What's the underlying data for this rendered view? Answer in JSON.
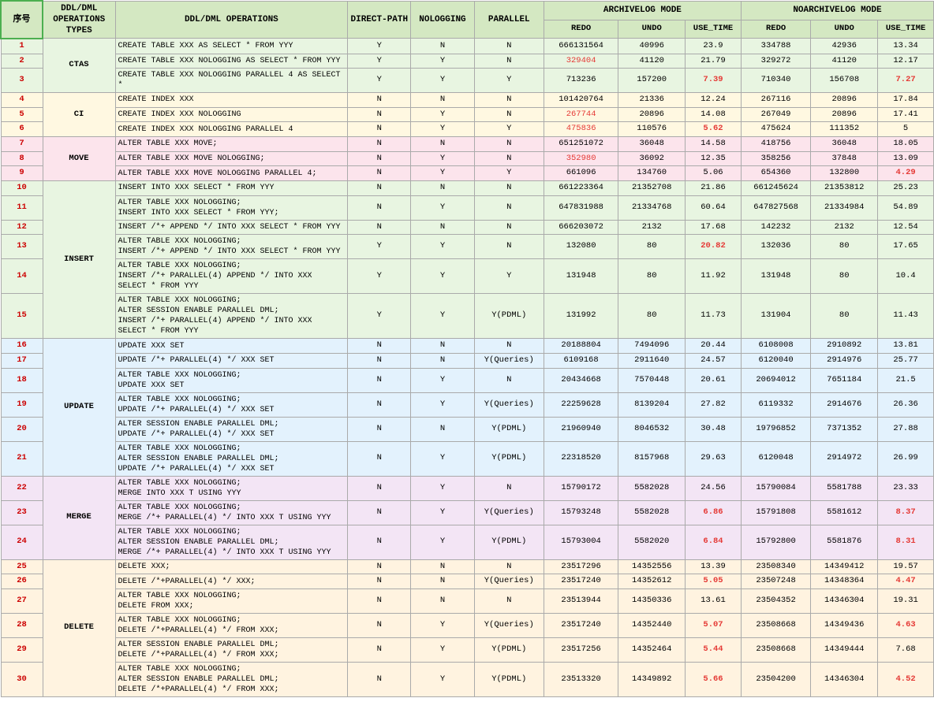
{
  "headers": {
    "col_a": "序号",
    "col_b": "DDL/DML OPERATIONS TYPES",
    "col_c": "DDL/DML OPERATIONS",
    "col_d": "DIRECT-PATH",
    "col_e": "NOLOGGING",
    "col_f": "PARALLEL",
    "archivelog": "ARCHIVELOG MODE",
    "g_redo": "REDO",
    "h_undo": "UNDO",
    "i_use_time": "USE_TIME",
    "noarchivelog": "NOARCHIVELOG MODE",
    "j_redo": "REDO",
    "k_undo": "UNDO",
    "l_use_time": "USE_TIME"
  },
  "rows": [
    {
      "num": "1",
      "op_group": "CTAS",
      "op_group_rows": 3,
      "ddl": "CREATE TABLE XXX AS SELECT * FROM YYY",
      "direct": "Y",
      "nolog": "N",
      "par": "N",
      "g": "666131564",
      "h": "40996",
      "i": "23.9",
      "i_red": false,
      "j": "334788",
      "k": "42936",
      "l": "13.34",
      "l_red": false,
      "bg": "ctas"
    },
    {
      "num": "2",
      "op_group": "",
      "ddl": "CREATE TABLE XXX NOLOGGING AS SELECT * FROM YYY",
      "direct": "Y",
      "nolog": "Y",
      "par": "N",
      "g": "329404",
      "h": "41120",
      "i": "21.79",
      "i_red": false,
      "j": "329272",
      "k": "41120",
      "l": "12.17",
      "l_red": false,
      "bg": "ctas"
    },
    {
      "num": "3",
      "op_group": "",
      "ddl": "CREATE TABLE XXX NOLOGGING PARALLEL 4 AS SELECT *",
      "direct": "Y",
      "nolog": "Y",
      "par": "Y",
      "g": "713236",
      "h": "157200",
      "i": "7.39",
      "i_red": true,
      "j": "710340",
      "k": "156708",
      "l": "7.27",
      "l_red": true,
      "bg": "ctas"
    },
    {
      "num": "4",
      "op_group": "CI",
      "op_group_rows": 3,
      "ddl": "CREATE INDEX XXX",
      "direct": "N",
      "nolog": "N",
      "par": "N",
      "g": "101420764",
      "h": "21336",
      "i": "12.24",
      "i_red": false,
      "j": "267116",
      "k": "20896",
      "l": "17.84",
      "l_red": false,
      "bg": "ci"
    },
    {
      "num": "5",
      "op_group": "",
      "ddl": "CREATE INDEX XXX NOLOGGING",
      "direct": "N",
      "nolog": "Y",
      "par": "N",
      "g": "267744",
      "h": "20896",
      "i": "14.08",
      "i_red": false,
      "j": "267049",
      "k": "20896",
      "l": "17.41",
      "l_red": false,
      "bg": "ci"
    },
    {
      "num": "6",
      "op_group": "",
      "ddl": "CREATE INDEX XXX NOLOGGING PARALLEL 4",
      "direct": "N",
      "nolog": "Y",
      "par": "Y",
      "g": "475836",
      "h": "110576",
      "i": "5.62",
      "i_red": true,
      "j": "475624",
      "k": "111352",
      "l": "5",
      "l_red": false,
      "bg": "ci"
    },
    {
      "num": "7",
      "op_group": "MOVE",
      "op_group_rows": 3,
      "ddl": "ALTER TABLE XXX MOVE;",
      "direct": "N",
      "nolog": "N",
      "par": "N",
      "g": "651251072",
      "h": "36048",
      "i": "14.58",
      "i_red": false,
      "j": "418756",
      "k": "36048",
      "l": "18.05",
      "l_red": false,
      "bg": "move"
    },
    {
      "num": "8",
      "op_group": "",
      "ddl": "ALTER TABLE XXX MOVE NOLOGGING;",
      "direct": "N",
      "nolog": "Y",
      "par": "N",
      "g": "352980",
      "h": "36092",
      "i": "12.35",
      "i_red": false,
      "j": "358256",
      "k": "37848",
      "l": "13.09",
      "l_red": false,
      "bg": "move"
    },
    {
      "num": "9",
      "op_group": "",
      "ddl": "ALTER TABLE XXX MOVE NOLOGGING PARALLEL 4;",
      "direct": "N",
      "nolog": "Y",
      "par": "Y",
      "g": "661096",
      "h": "134760",
      "i": "5.06",
      "i_red": false,
      "j": "654360",
      "k": "132800",
      "l": "4.29",
      "l_red": true,
      "bg": "move"
    },
    {
      "num": "10",
      "op_group": "INSERT",
      "op_group_rows": 6,
      "ddl": "INSERT INTO XXX SELECT * FROM YYY",
      "direct": "N",
      "nolog": "N",
      "par": "N",
      "g": "661223364",
      "h": "21352708",
      "i": "21.86",
      "i_red": false,
      "j": "661245624",
      "k": "21353812",
      "l": "25.23",
      "l_red": false,
      "bg": "insert"
    },
    {
      "num": "11",
      "op_group": "",
      "ddl": "ALTER TABLE XXX NOLOGGING;\nINSERT INTO XXX SELECT * FROM YYY;",
      "direct": "N",
      "nolog": "Y",
      "par": "N",
      "g": "647831988",
      "h": "21334768",
      "i": "60.64",
      "i_red": false,
      "j": "647827568",
      "k": "21334984",
      "l": "54.89",
      "l_red": false,
      "bg": "insert"
    },
    {
      "num": "12",
      "op_group": "",
      "ddl": "INSERT /*+ APPEND */ INTO XXX SELECT * FROM YYY",
      "direct": "N",
      "nolog": "N",
      "par": "N",
      "g": "666203072",
      "h": "2132",
      "i": "17.68",
      "i_red": false,
      "j": "142232",
      "k": "2132",
      "l": "12.54",
      "l_red": false,
      "bg": "insert"
    },
    {
      "num": "13",
      "op_group": "",
      "ddl": "ALTER TABLE XXX NOLOGGING;\nINSERT /*+ APPEND */ INTO XXX SELECT * FROM YYY",
      "direct": "Y",
      "nolog": "Y",
      "par": "N",
      "g": "132080",
      "h": "80",
      "i": "20.82",
      "i_red": true,
      "j": "132036",
      "k": "80",
      "l": "17.65",
      "l_red": false,
      "bg": "insert"
    },
    {
      "num": "14",
      "op_group": "",
      "ddl": "ALTER TABLE XXX NOLOGGING;\nINSERT /*+ PARALLEL(4) APPEND */ INTO XXX SELECT * FROM YYY",
      "direct": "Y",
      "nolog": "Y",
      "par": "Y",
      "g": "131948",
      "h": "80",
      "i": "11.92",
      "i_red": false,
      "j": "131948",
      "k": "80",
      "l": "10.4",
      "l_red": false,
      "bg": "insert"
    },
    {
      "num": "15",
      "op_group": "",
      "ddl": "ALTER TABLE XXX NOLOGGING;\nALTER SESSION ENABLE PARALLEL DML;\nINSERT /*+ PARALLEL(4) APPEND */ INTO XXX SELECT * FROM YYY",
      "direct": "Y",
      "nolog": "Y",
      "par": "Y(PDML)",
      "g": "131992",
      "h": "80",
      "i": "11.73",
      "i_red": false,
      "j": "131904",
      "k": "80",
      "l": "11.43",
      "l_red": false,
      "bg": "insert"
    },
    {
      "num": "16",
      "op_group": "UPDATE",
      "op_group_rows": 6,
      "ddl": "UPDATE XXX SET",
      "direct": "N",
      "nolog": "N",
      "par": "N",
      "g": "20188804",
      "h": "7494096",
      "i": "20.44",
      "i_red": false,
      "j": "6108008",
      "k": "2910892",
      "l": "13.81",
      "l_red": false,
      "bg": "update"
    },
    {
      "num": "17",
      "op_group": "",
      "ddl": "UPDATE /*+ PARALLEL(4) */ XXX SET",
      "direct": "N",
      "nolog": "N",
      "par": "Y(Queries)",
      "g": "6109168",
      "h": "2911640",
      "i": "24.57",
      "i_red": false,
      "j": "6120040",
      "k": "2914976",
      "l": "25.77",
      "l_red": false,
      "bg": "update"
    },
    {
      "num": "18",
      "op_group": "",
      "ddl": "ALTER TABLE XXX NOLOGGING;\nUPDATE XXX SET",
      "direct": "N",
      "nolog": "Y",
      "par": "N",
      "g": "20434668",
      "h": "7570448",
      "i": "20.61",
      "i_red": false,
      "j": "20694012",
      "k": "7651184",
      "l": "21.5",
      "l_red": false,
      "bg": "update"
    },
    {
      "num": "19",
      "op_group": "",
      "ddl": "ALTER TABLE XXX NOLOGGING;\nUPDATE /*+ PARALLEL(4) */ XXX SET",
      "direct": "N",
      "nolog": "Y",
      "par": "Y(Queries)",
      "g": "22259628",
      "h": "8139204",
      "i": "27.82",
      "i_red": false,
      "j": "6119332",
      "k": "2914676",
      "l": "26.36",
      "l_red": false,
      "bg": "update"
    },
    {
      "num": "20",
      "op_group": "",
      "ddl": "ALTER SESSION ENABLE PARALLEL DML;\nUPDATE /*+ PARALLEL(4) */ XXX SET",
      "direct": "N",
      "nolog": "N",
      "par": "Y(PDML)",
      "g": "21960940",
      "h": "8046532",
      "i": "30.48",
      "i_red": false,
      "j": "19796852",
      "k": "7371352",
      "l": "27.88",
      "l_red": false,
      "bg": "update"
    },
    {
      "num": "21",
      "op_group": "",
      "ddl": "ALTER TABLE XXX NOLOGGING;\nALTER SESSION ENABLE PARALLEL DML;\nUPDATE /*+ PARALLEL(4) */ XXX SET",
      "direct": "N",
      "nolog": "Y",
      "par": "Y(PDML)",
      "g": "22318520",
      "h": "8157968",
      "i": "29.63",
      "i_red": false,
      "j": "6120048",
      "k": "2914972",
      "l": "26.99",
      "l_red": false,
      "bg": "update"
    },
    {
      "num": "22",
      "op_group": "MERGE",
      "op_group_rows": 3,
      "ddl": "ALTER TABLE XXX NOLOGGING;\nMERGE  INTO XXX T USING YYY",
      "direct": "N",
      "nolog": "Y",
      "par": "N",
      "g": "15790172",
      "h": "5582028",
      "i": "24.56",
      "i_red": false,
      "j": "15790084",
      "k": "5581788",
      "l": "23.33",
      "l_red": false,
      "bg": "merge"
    },
    {
      "num": "23",
      "op_group": "",
      "ddl": "ALTER TABLE XXX NOLOGGING;\nMERGE /*+ PARALLEL(4) */ INTO XXX T USING YYY",
      "direct": "N",
      "nolog": "Y",
      "par": "Y(Queries)",
      "g": "15793248",
      "h": "5582028",
      "i": "6.86",
      "i_red": true,
      "j": "15791808",
      "k": "5581612",
      "l": "8.37",
      "l_red": true,
      "bg": "merge"
    },
    {
      "num": "24",
      "op_group": "",
      "ddl": "ALTER TABLE XXX NOLOGGING;\nALTER SESSION ENABLE PARALLEL DML;\nMERGE /*+ PARALLEL(4) */ INTO XXX T USING YYY",
      "direct": "N",
      "nolog": "Y",
      "par": "Y(PDML)",
      "g": "15793004",
      "h": "5582020",
      "i": "6.84",
      "i_red": true,
      "j": "15792800",
      "k": "5581876",
      "l": "8.31",
      "l_red": true,
      "bg": "merge"
    },
    {
      "num": "25",
      "op_group": "DELETE",
      "op_group_rows": 6,
      "ddl": "DELETE XXX;",
      "direct": "N",
      "nolog": "N",
      "par": "N",
      "g": "23517296",
      "h": "14352556",
      "i": "13.39",
      "i_red": false,
      "j": "23508340",
      "k": "14349412",
      "l": "19.57",
      "l_red": false,
      "bg": "delete"
    },
    {
      "num": "26",
      "op_group": "",
      "ddl": "DELETE /*+PARALLEL(4) */ XXX;",
      "direct": "N",
      "nolog": "N",
      "par": "Y(Queries)",
      "g": "23517240",
      "h": "14352612",
      "i": "5.05",
      "i_red": true,
      "j": "23507248",
      "k": "14348364",
      "l": "4.47",
      "l_red": true,
      "bg": "delete"
    },
    {
      "num": "27",
      "op_group": "",
      "ddl": "ALTER TABLE XXX NOLOGGING;\nDELETE FROM XXX;",
      "direct": "N",
      "nolog": "N",
      "par": "N",
      "g": "23513944",
      "h": "14350336",
      "i": "13.61",
      "i_red": false,
      "j": "23504352",
      "k": "14346304",
      "l": "19.31",
      "l_red": false,
      "bg": "delete"
    },
    {
      "num": "28",
      "op_group": "",
      "ddl": "ALTER TABLE XXX NOLOGGING;\nDELETE /*+PARALLEL(4) */ FROM  XXX;",
      "direct": "N",
      "nolog": "Y",
      "par": "Y(Queries)",
      "g": "23517240",
      "h": "14352440",
      "i": "5.07",
      "i_red": true,
      "j": "23508668",
      "k": "14349436",
      "l": "4.63",
      "l_red": true,
      "bg": "delete"
    },
    {
      "num": "29",
      "op_group": "",
      "ddl": "ALTER SESSION ENABLE PARALLEL DML;\nDELETE /*+PARALLEL(4) */  FROM  XXX;",
      "direct": "N",
      "nolog": "Y",
      "par": "Y(PDML)",
      "g": "23517256",
      "h": "14352464",
      "i": "5.44",
      "i_red": true,
      "j": "23508668",
      "k": "14349444",
      "l": "7.68",
      "l_red": false,
      "bg": "delete"
    },
    {
      "num": "30",
      "op_group": "",
      "ddl": "ALTER TABLE XXX NOLOGGING;\nALTER SESSION ENABLE PARALLEL DML;\nDELETE /*+PARALLEL(4) */  FROM  XXX;",
      "direct": "N",
      "nolog": "Y",
      "par": "Y(PDML)",
      "g": "23513320",
      "h": "14349892",
      "i": "5.66",
      "i_red": true,
      "j": "23504200",
      "k": "14346304",
      "l": "4.52",
      "l_red": true,
      "bg": "delete"
    }
  ]
}
